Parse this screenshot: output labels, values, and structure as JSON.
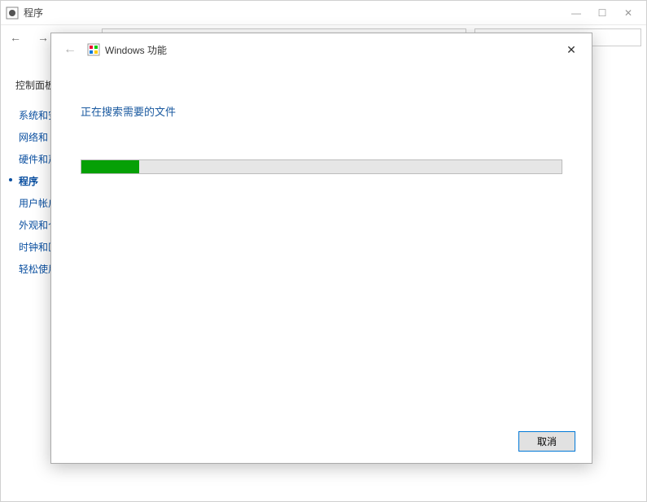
{
  "outer": {
    "title": "程序",
    "controls": {
      "min": "—",
      "max": "☐",
      "close": "✕"
    }
  },
  "nav": {
    "back": "←",
    "forward": "→"
  },
  "sidebar": {
    "heading": "控制面板",
    "items": [
      {
        "label": "系统和安全",
        "active": false
      },
      {
        "label": "网络和 Internet",
        "active": false
      },
      {
        "label": "硬件和声音",
        "active": false
      },
      {
        "label": "程序",
        "active": true
      },
      {
        "label": "用户帐户",
        "active": false
      },
      {
        "label": "外观和个性化",
        "active": false
      },
      {
        "label": "时钟和区域",
        "active": false
      },
      {
        "label": "轻松使用",
        "active": false
      }
    ]
  },
  "modal": {
    "back": "←",
    "title": "Windows 功能",
    "close": "✕",
    "status": "正在搜索需要的文件",
    "progress_percent": 12,
    "cancel_label": "取消"
  }
}
